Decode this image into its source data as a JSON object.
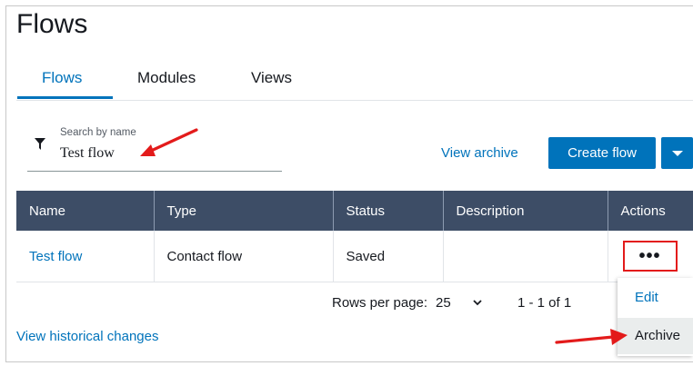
{
  "page": {
    "title": "Flows"
  },
  "tabs": [
    {
      "label": "Flows",
      "active": true
    },
    {
      "label": "Modules",
      "active": false
    },
    {
      "label": "Views",
      "active": false
    }
  ],
  "search": {
    "label": "Search by name",
    "value": "Test flow",
    "icon": "filter-icon"
  },
  "toolbar": {
    "view_archive": "View archive",
    "create_flow": "Create flow",
    "dropdown_icon": "caret-down-icon"
  },
  "table": {
    "columns": [
      "Name",
      "Type",
      "Status",
      "Description",
      "Actions"
    ],
    "rows": [
      {
        "name": "Test flow",
        "type": "Contact flow",
        "status": "Saved",
        "description": "",
        "actions": "•••"
      }
    ]
  },
  "pagination": {
    "rows_per_page_label": "Rows per page:",
    "rows_per_page_value": "25",
    "range": "1 - 1 of 1"
  },
  "footer": {
    "history_link": "View historical changes"
  },
  "actions_menu": {
    "items": [
      "Edit",
      "Archive"
    ]
  },
  "colors": {
    "accent": "#0073bb",
    "header": "#3d4d66",
    "highlight": "#e31b1b"
  }
}
